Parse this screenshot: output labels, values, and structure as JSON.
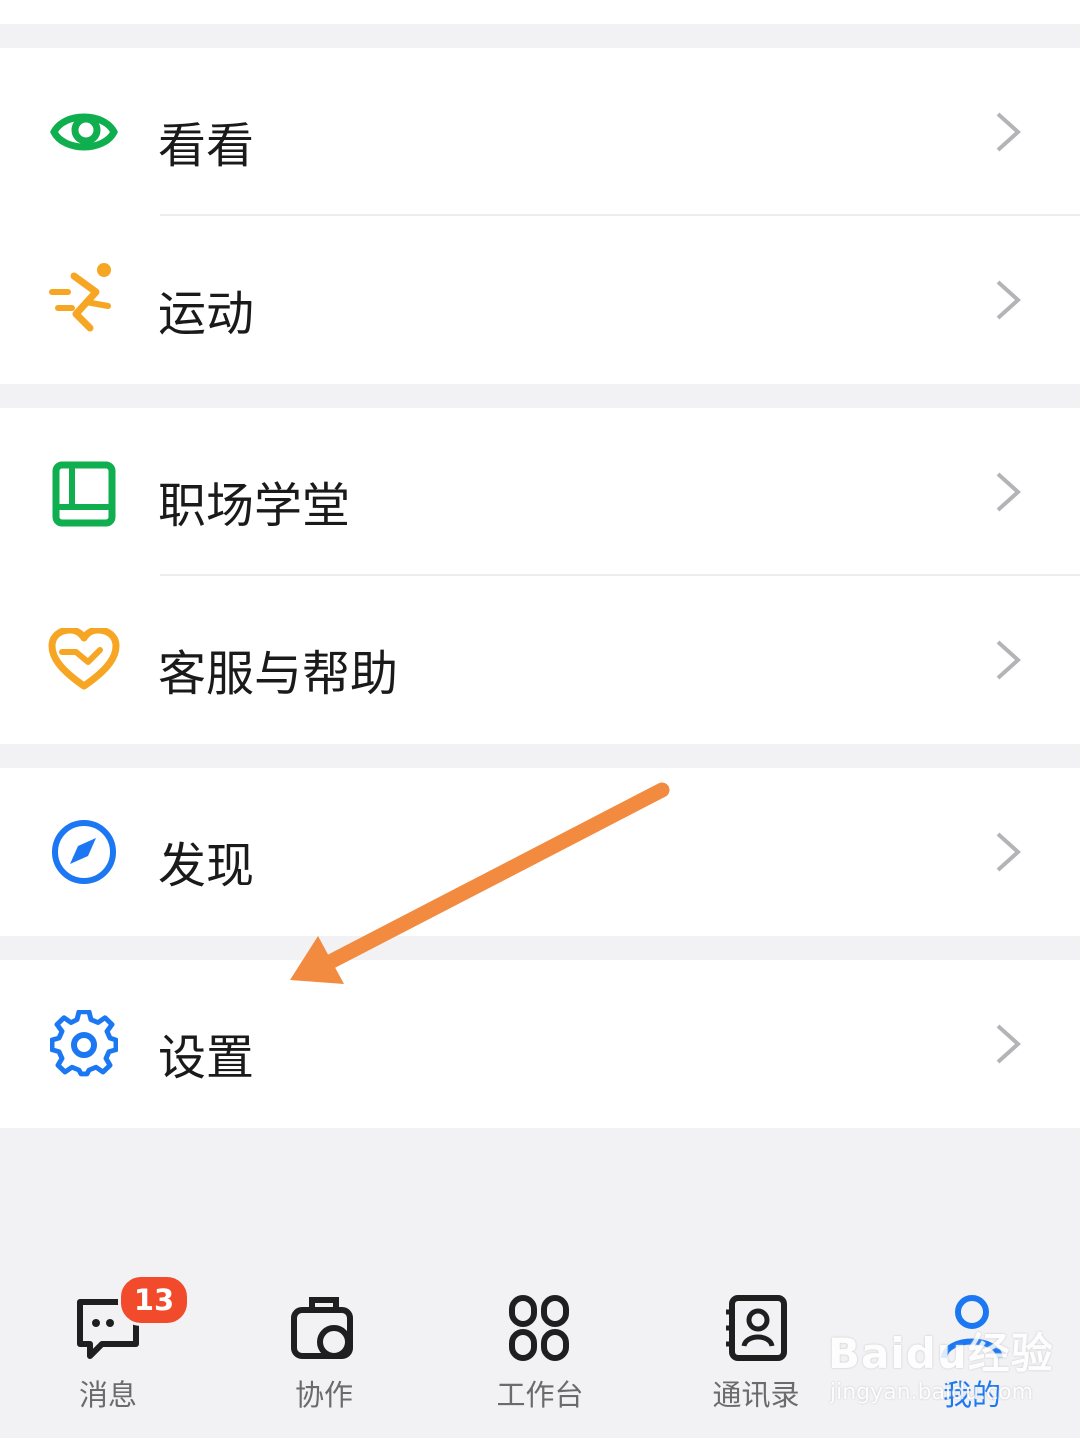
{
  "menu": {
    "items": [
      {
        "key": "kankan",
        "label": "看看",
        "icon": "eye-icon"
      },
      {
        "key": "yundong",
        "label": "运动",
        "icon": "running-icon"
      },
      {
        "key": "zhichang",
        "label": "职场学堂",
        "icon": "book-icon"
      },
      {
        "key": "kefu",
        "label": "客服与帮助",
        "icon": "heart-icon"
      },
      {
        "key": "faxian",
        "label": "发现",
        "icon": "compass-icon"
      },
      {
        "key": "shezhi",
        "label": "设置",
        "icon": "gear-icon"
      }
    ]
  },
  "tabbar": {
    "tabs": [
      {
        "label": "消息",
        "icon": "message-icon",
        "badge": "13",
        "active": false
      },
      {
        "label": "协作",
        "icon": "briefcase-icon",
        "active": false
      },
      {
        "label": "工作台",
        "icon": "grid-icon",
        "active": false
      },
      {
        "label": "通讯录",
        "icon": "contacts-icon",
        "active": false
      },
      {
        "label": "我的",
        "icon": "profile-icon",
        "active": true
      }
    ]
  },
  "watermark": {
    "logo": "Baidu经验",
    "url": "jingyan.baidu.com"
  },
  "colors": {
    "green": "#0fae4e",
    "orange": "#f6a623",
    "blue": "#1b78f2",
    "annotation_arrow": "#f28b3f",
    "badge": "#f14b2b"
  }
}
